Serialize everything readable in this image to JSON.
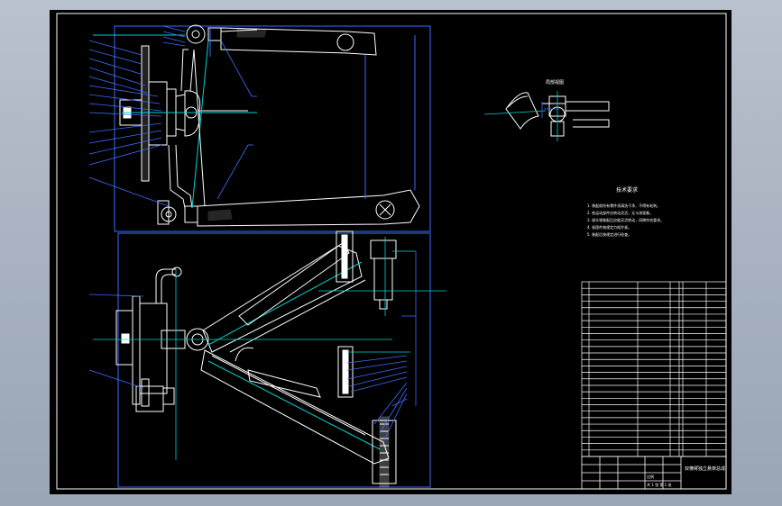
{
  "title": "",
  "notes": {
    "heading": "技术要求",
    "lines": [
      "1. 装配前所有零件须清洗干净，不得有毛刺。",
      "2. 各运动部件应转动灵活，无卡滞现象。",
      "3. 球头销装配后应能灵活转动，间隙符合要求。",
      "4. 紧固件按规定力矩拧紧。",
      "5. 装配后按规定进行检查。"
    ]
  },
  "detail_label": "局部视图",
  "title_block": {
    "drawing_name": "双横臂独立悬架总成",
    "scale_label": "比例",
    "sheet_label": "共 1 张  第 1 张"
  },
  "colors": {
    "frame": "#ffffff",
    "outline": "#ffffff",
    "leader": "#2a2aff",
    "centerline": "#00d5d5",
    "spring": "#ffff00",
    "chain": "#3a6dff"
  }
}
